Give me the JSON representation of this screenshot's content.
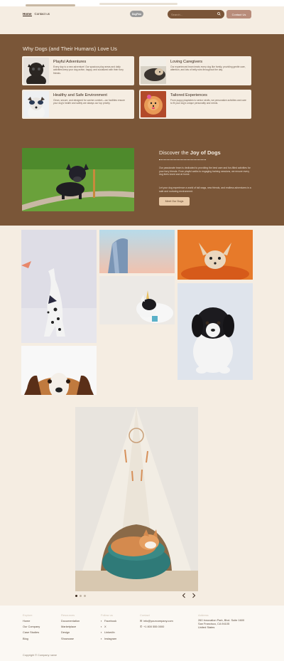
{
  "nav": {
    "home": "Home",
    "contact_us": "Contact us"
  },
  "logo": {
    "text": "DogPaw"
  },
  "search": {
    "placeholder": "Search...",
    "icon": "search-icon"
  },
  "header": {
    "contact_button": "Contact Us"
  },
  "why": {
    "title": "Why Dogs (and Their Humans) Love Us",
    "cards": [
      {
        "title": "Playful Adventures",
        "text": "Every day is a new adventure! Our spacious play areas and daily activities keep your dog active, happy, and socialized with their furry friends."
      },
      {
        "title": "Loving Caregivers",
        "text": "Our experienced team treats every dog like family, providing gentle care, attention, and lots of belly rubs throughout the day."
      },
      {
        "title": "Healthy and Safe Environment",
        "text": "Clean, secure, and designed for canine comfort—our facilities ensure your dog's health and safety are always our top priority."
      },
      {
        "title": "Tailored Experiences",
        "text": "From puppy playdates to senior strolls, we personalize activities and care to fit your dog's unique personality and needs."
      }
    ]
  },
  "discover": {
    "title_prefix": "Discover the ",
    "title_bold": "Joy of Dogs",
    "p1": "Our passionate team is dedicated to providing the best care and fun-filled activities for your furry friends. From playful walks to engaging training sessions, we ensure every dog feels loved and at home.",
    "p2": "Let your dog experience a world of tail wags, new friends, and endless adventures in a safe and nurturing environment.",
    "button": "Meet Our Dogs"
  },
  "carousel": {
    "slide_count": 3,
    "active_index": 0,
    "prev_icon": "chevron-left-icon",
    "next_icon": "chevron-right-icon"
  },
  "footer": {
    "col1": {
      "heading": "Explore",
      "links": [
        "Home",
        "Our Company",
        "Case Studies",
        "Blog"
      ]
    },
    "col2": {
      "heading": "Resources",
      "links": [
        "Documentation",
        "Marketplace",
        "Design",
        "Showcase"
      ]
    },
    "col3": {
      "heading": "Follow us",
      "links": [
        "Facebook",
        "X",
        "LinkedIn",
        "Instagram"
      ]
    },
    "col4": {
      "heading": "Contact",
      "email": "info@yourcompany.com",
      "phone": "+1 800 555 0000"
    },
    "col5": {
      "heading": "Address",
      "line1": "260 Innovation Park, Blvd. Suite 1600",
      "line2": "San Francisco, CA 94105",
      "line3": "United States"
    },
    "copyright": "Copyright © Company name"
  },
  "colors": {
    "brown": "#7a5638",
    "cream": "#f5ede2",
    "accent": "#b88c7a",
    "button_light": "#e8c9a7"
  }
}
